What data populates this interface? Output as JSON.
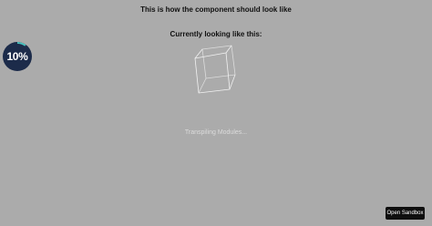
{
  "headings": {
    "expected": "This is how the component should look like",
    "current": "Currently looking like this:"
  },
  "progress": {
    "label": "10%",
    "value": 0.1,
    "ring_color": "#49c4c0",
    "fill_color": "#1c2b4a"
  },
  "cube": {
    "icon": "wireframe-cube"
  },
  "status": {
    "text": "Transpiling Modules..."
  },
  "sandbox": {
    "button_label": "Open Sandbox"
  }
}
